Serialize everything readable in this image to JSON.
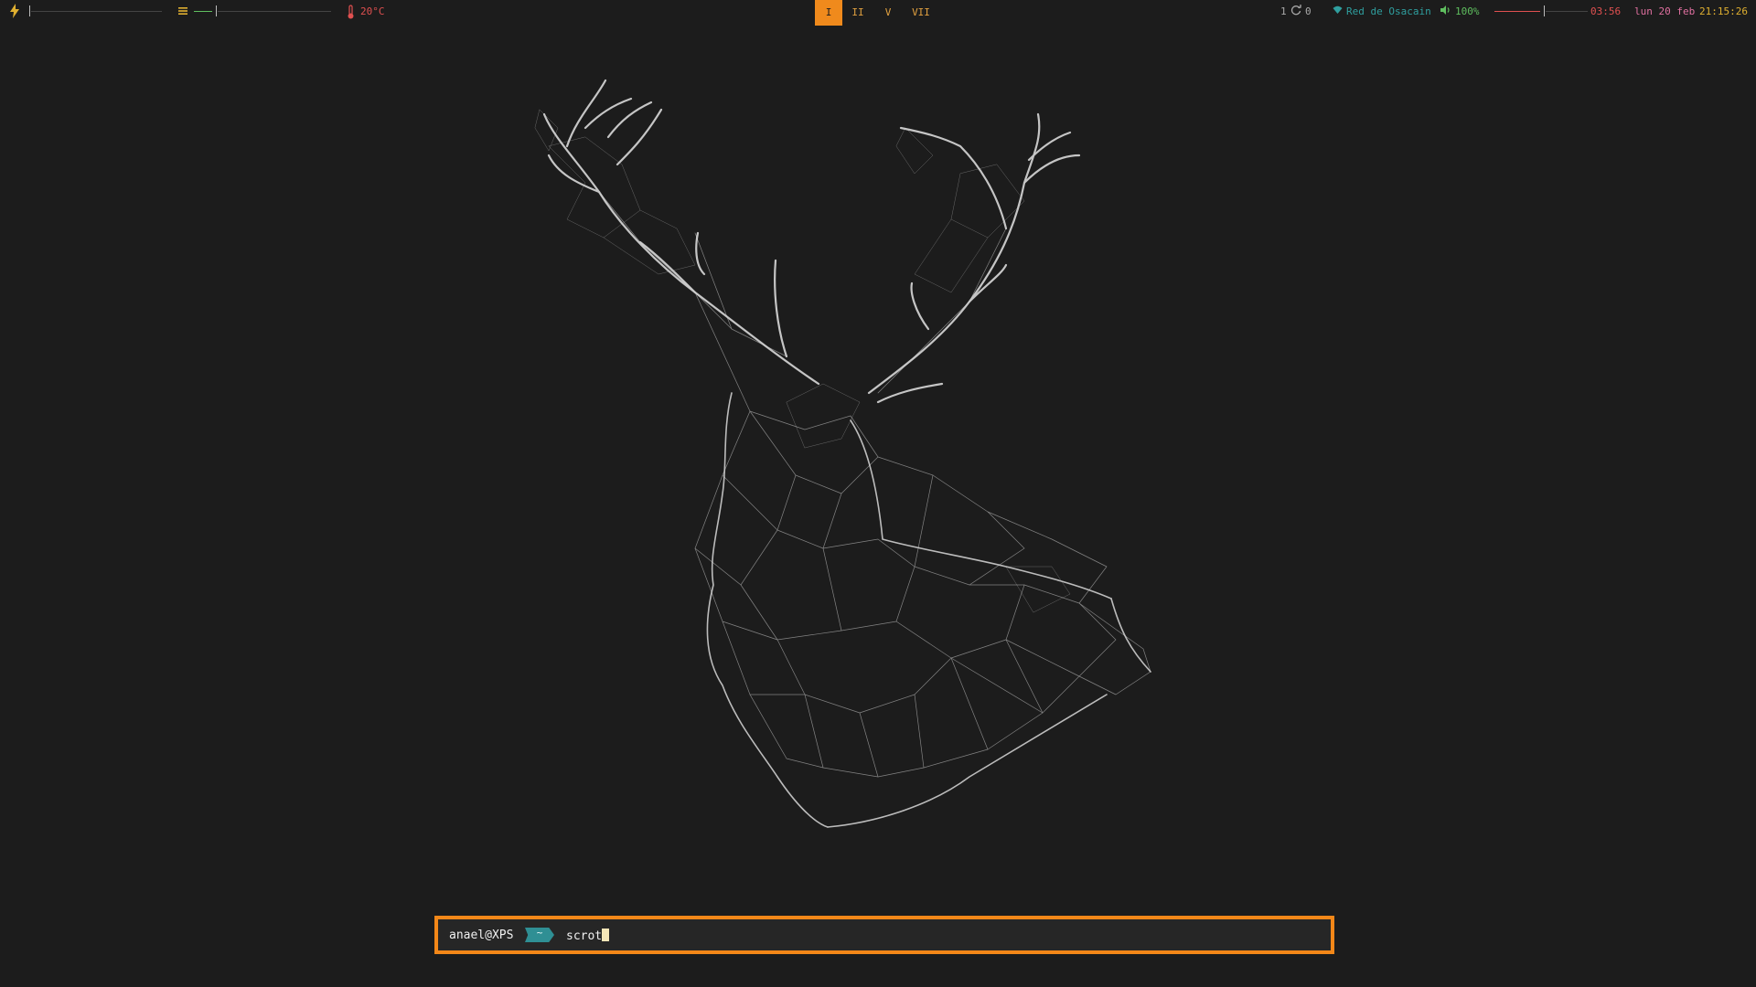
{
  "topbar": {
    "left": {
      "power_icon": "lightning-icon",
      "menu_icon": "hamburger-icon",
      "temperature_icon": "thermometer-icon",
      "temperature": "20°C"
    },
    "workspaces": [
      {
        "label": "I",
        "active": true
      },
      {
        "label": "II",
        "active": false
      },
      {
        "label": "V",
        "active": false
      },
      {
        "label": "VII",
        "active": false
      }
    ],
    "right": {
      "updates_count": "1",
      "updates_icon": "refresh-icon",
      "updates_pending": "0",
      "wifi_icon": "wifi-icon",
      "network_name": "Red de Osacain",
      "volume_icon": "speaker-icon",
      "volume": "100%",
      "battery_time": "03:56",
      "date": "lun 20 feb",
      "time": "21:15:26"
    }
  },
  "terminal": {
    "user_host": "anael@XPS",
    "directory": "~",
    "command": "scrot"
  },
  "colors": {
    "background": "#1c1c1c",
    "accent": "#f38718",
    "teal": "#2f8f94",
    "yellow": "#e0b030",
    "red": "#e05050",
    "green": "#5fbf5f"
  },
  "wallpaper_icon": "deer-head-icon"
}
